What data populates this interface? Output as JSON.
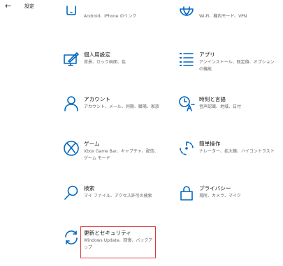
{
  "window": {
    "back_glyph": "←",
    "title": "設定"
  },
  "tiles": [
    {
      "name": "",
      "desc": "Android、iPhone のリンク",
      "icon": "phone-icon"
    },
    {
      "name": "",
      "desc": "Wi-Fi、機内モード、VPN",
      "icon": "globe-icon"
    },
    {
      "name": "個人用設定",
      "desc": "背景、ロック画面、色",
      "icon": "personalization-icon"
    },
    {
      "name": "アプリ",
      "desc": "アンインストール、既定値、オプションの機能",
      "icon": "apps-list-icon"
    },
    {
      "name": "アカウント",
      "desc": "アカウント、メール、同期、職場、家族",
      "icon": "person-icon"
    },
    {
      "name": "時刻と言語",
      "desc": "音声認識、地域、日付",
      "icon": "time-language-icon"
    },
    {
      "name": "ゲーム",
      "desc": "Xbox Game Bar、キャプチャ、配信、ゲーム モード",
      "icon": "xbox-icon"
    },
    {
      "name": "簡単操作",
      "desc": "ナレーター、拡大鏡、ハイコントラスト",
      "icon": "ease-of-access-icon"
    },
    {
      "name": "検索",
      "desc": "マイ ファイル、アクセス許可の検索",
      "icon": "search-icon"
    },
    {
      "name": "プライバシー",
      "desc": "場所、カメラ、マイク",
      "icon": "lock-icon"
    },
    {
      "name": "更新とセキュリティ",
      "desc": "Windows Update、回復、バックアップ",
      "icon": "sync-arrows-icon"
    }
  ],
  "colors": {
    "accent": "#0067c0",
    "highlight_border": "#d83b3b"
  }
}
